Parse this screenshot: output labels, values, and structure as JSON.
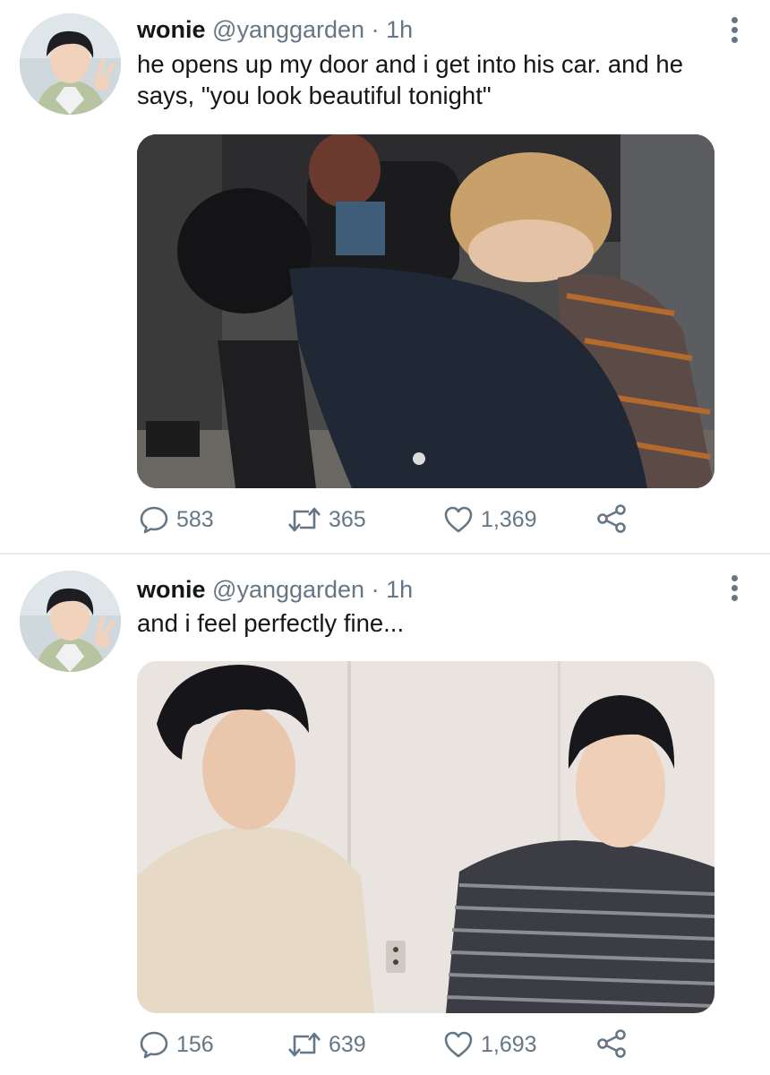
{
  "tweets": [
    {
      "name": "wonie",
      "handle": "@yanggarden",
      "separator": "·",
      "time": "1h",
      "text": "he opens up my door and i get into his car. and he says, \"you look beautiful tonight\"",
      "counts": {
        "replies": "583",
        "retweets": "365",
        "likes": "1,369"
      }
    },
    {
      "name": "wonie",
      "handle": "@yanggarden",
      "separator": "·",
      "time": "1h",
      "text": "and i feel perfectly fine...",
      "counts": {
        "replies": "156",
        "retweets": "639",
        "likes": "1,693"
      }
    }
  ],
  "icons": [
    "reply-icon",
    "retweet-icon",
    "like-icon",
    "share-icon",
    "more-options-icon"
  ],
  "colors": {
    "muted": "#657786",
    "text": "#14171a",
    "divider": "#e6ecf0"
  }
}
